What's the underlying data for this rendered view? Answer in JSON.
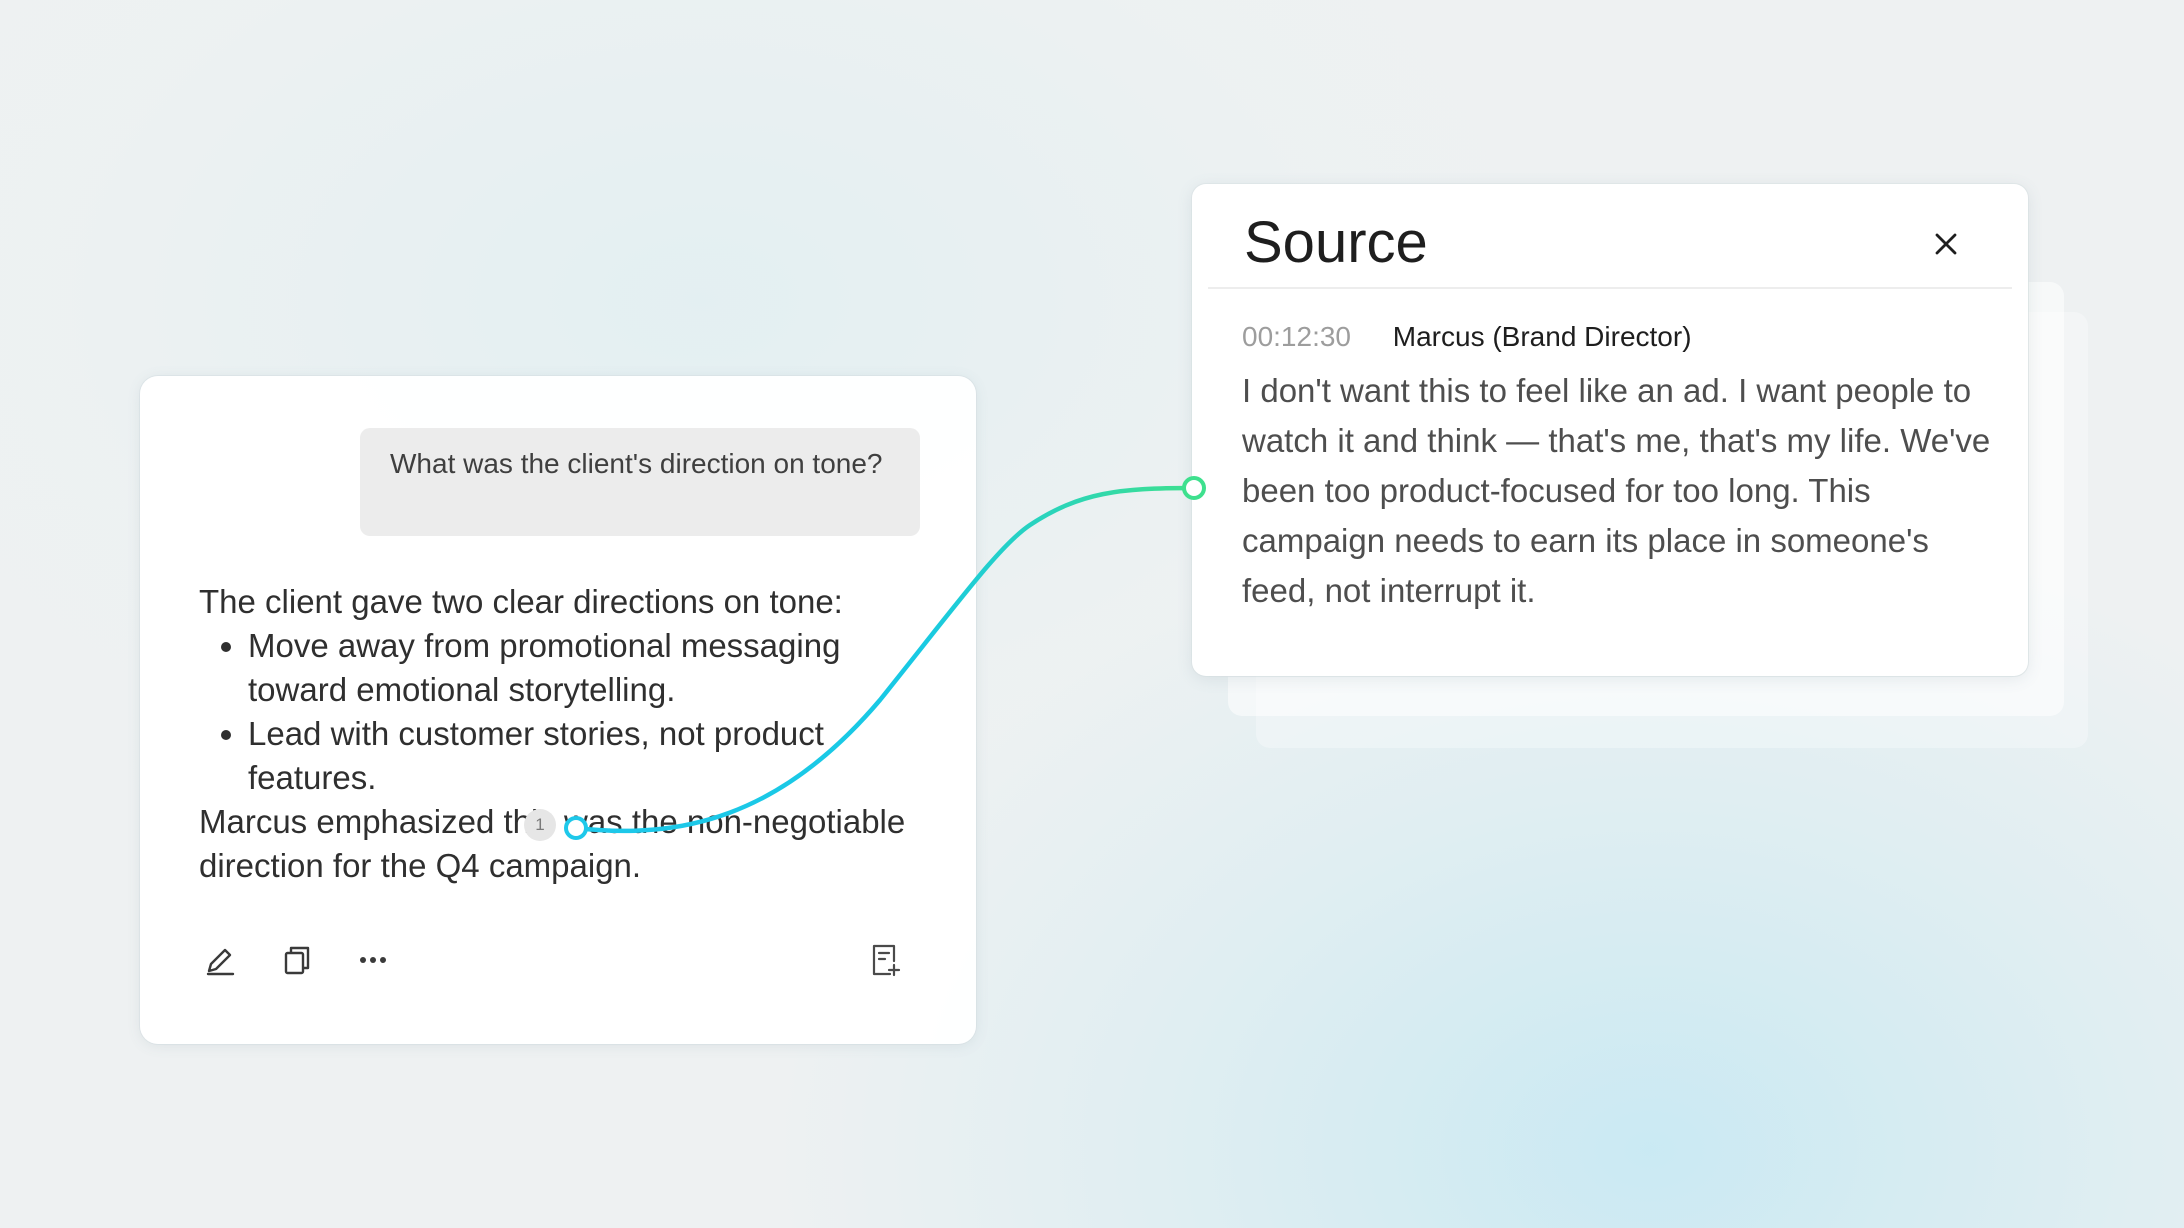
{
  "chat": {
    "question": "What was the client's direction on tone?",
    "answer_intro": "The client gave two clear directions on tone:",
    "bullets": [
      "Move away from promotional messaging toward emotional storytelling.",
      "Lead with customer stories, not product features."
    ],
    "answer_outro": "Marcus emphasized this was the non-negotiable direction for the Q4 campaign.",
    "citation_number": "1",
    "toolbar": {
      "edit_icon": "pen-icon",
      "copy_icon": "copy-icon",
      "more_icon": "more-horizontal-icon",
      "add_to_note_icon": "add-to-note-icon"
    }
  },
  "source": {
    "title": "Source",
    "close_icon": "close-icon",
    "timestamp": "00:12:30",
    "speaker": "Marcus (Brand Director)",
    "quote": "I don't want this to feel like an ad. I want people to watch it and think — that's me, that's my life. We've been too product-focused for too long. This campaign needs to earn its place in someone's feed, not interrupt it."
  },
  "colors": {
    "connector_start": "#1ec8ea",
    "connector_end": "#3ee08e",
    "bubble_background": "#ececec"
  }
}
